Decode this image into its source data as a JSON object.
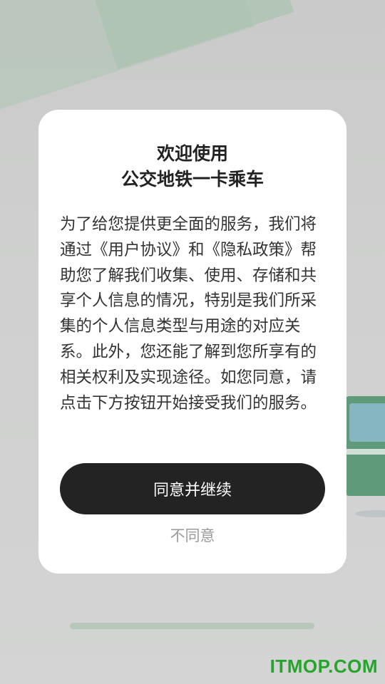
{
  "dialog": {
    "title_line1": "欢迎使用",
    "title_line2": "公交地铁一卡乘车",
    "body": "为了给您提供更全面的服务，我们将通过《用户协议》和《隐私政策》帮助您了解我们收集、使用、存储和共享个人信息的情况，特别是我们所采集的个人信息类型与用途的对应关系。此外，您还能了解到您所享有的相关权利及实现途径。如您同意，请点击下方按钮开始接受我们的服务。",
    "agree_label": "同意并继续",
    "disagree_label": "不同意"
  },
  "watermark": "ITMOP.COM",
  "colors": {
    "background": "#cfd0cf",
    "dialog_bg": "#ffffff",
    "agree_button_bg": "#232323",
    "disagree_text": "#9a9a9a",
    "bus_green": "#5f9a7a",
    "watermark_green": "#25a52b"
  }
}
